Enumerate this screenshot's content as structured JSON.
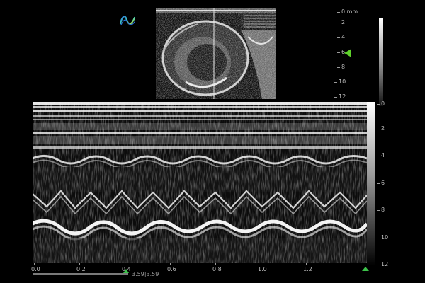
{
  "colors": {
    "accent": "#5ed12a",
    "logo_gradient": [
      "#2b73d9",
      "#3fd0c0",
      "#c2e33b"
    ]
  },
  "icons": {
    "logo": "vevo-wave-logo"
  },
  "depth_scale": {
    "unit_label": "0 mm",
    "labels": [
      "2",
      "4",
      "6",
      "8",
      "10",
      "12"
    ]
  },
  "mmode_depth": {
    "labels": [
      "0",
      "2",
      "4",
      "6",
      "8",
      "10",
      "12"
    ]
  },
  "time_axis": {
    "labels": [
      "0.0",
      "0.2",
      "0.4",
      "0.6",
      "0.8",
      "1.0",
      "1.2"
    ]
  },
  "scroll": {
    "position_text": "3.59|3.59",
    "progress": 0.27
  }
}
